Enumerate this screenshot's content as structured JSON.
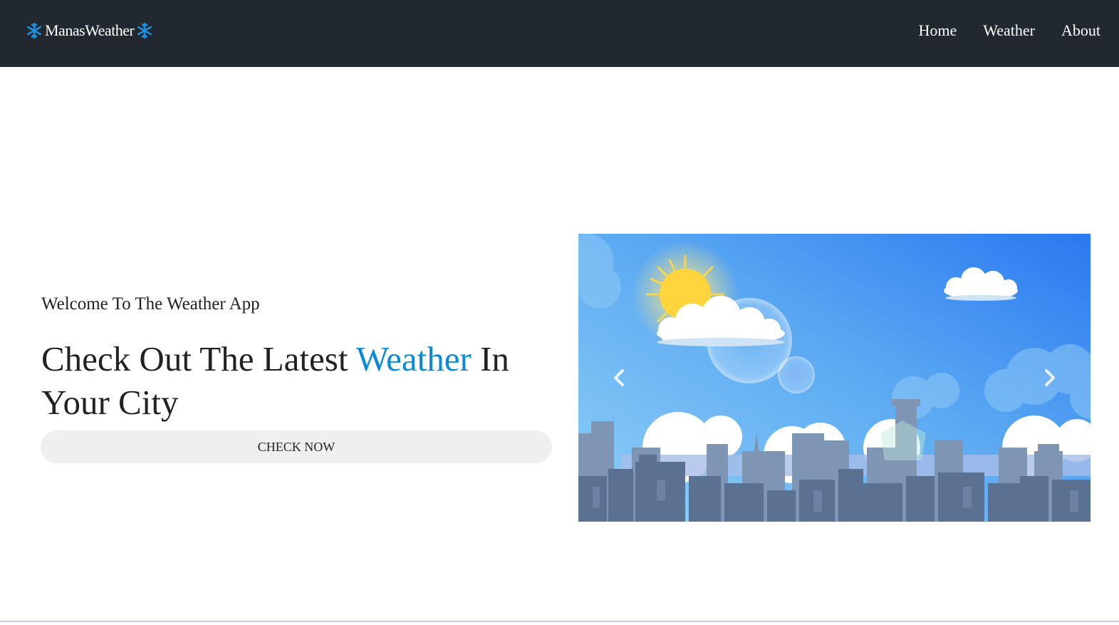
{
  "navbar": {
    "brand_text": "ManasWeather",
    "brand_icon": "snowflake-icon",
    "links": [
      {
        "label": "Home"
      },
      {
        "label": "Weather"
      },
      {
        "label": "About"
      }
    ]
  },
  "hero": {
    "welcome_text": "Welcome To The Weather App",
    "headline_part1": "Check Out The Latest ",
    "headline_accent": "Weather",
    "headline_part2": " In Your City",
    "button_label": "CHECK NOW",
    "accent_color": "#0b8ad8"
  },
  "carousel": {
    "image": "sunny-city-skyline-illustration",
    "prev_icon": "chevron-left-icon",
    "next_icon": "chevron-right-icon"
  },
  "colors": {
    "navbar_bg": "#212830",
    "nav_text": "#ffffff",
    "button_bg": "#efefef",
    "sky_top": "#2f7df0",
    "sky_bottom": "#7bc3f5",
    "building": "#5a7192"
  }
}
